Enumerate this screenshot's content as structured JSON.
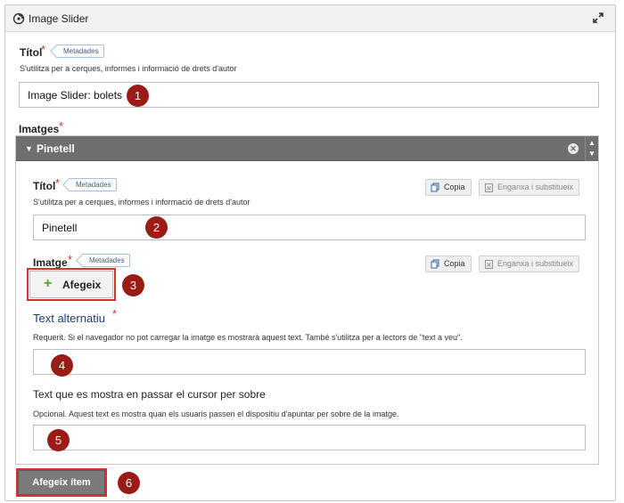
{
  "header": {
    "title": "Image Slider",
    "title_icon": "slider-icon",
    "expand_icon": "expand-icon"
  },
  "titol": {
    "label": "Títol",
    "required_mark": "*",
    "badge": "Metadades",
    "help": "S'utilitza per a cerques, informes i informació de drets d'autor",
    "value": "Image Slider: bolets"
  },
  "imatges": {
    "label": "Imatges",
    "required_mark": "*",
    "item": {
      "title": "Pinetell",
      "caret": "▼",
      "close": "✕",
      "titol": {
        "label": "Títol",
        "required_mark": "*",
        "badge": "Metadades",
        "help": "S'utilitza per a cerques, informes i informació de drets d'autor",
        "value": "Pinetell",
        "copy": "Copia",
        "paste": "Enganxa i substitueix"
      },
      "imatge": {
        "label": "Imatge",
        "required_mark": "*",
        "badge": "Metadades",
        "add": "Afegeix",
        "add_icon": "+",
        "copy": "Copia",
        "paste": "Enganxa i substitueix"
      },
      "alt": {
        "label": "Text alternatiu",
        "required_mark": "*",
        "help": "Requerit. Si el navegador no pot carregar la imatge es mostrarà aquest text. També s'utilitza per a lectors de \"text a veu\".",
        "value": ""
      },
      "hover": {
        "label": "Text que es mostra en passar el cursor per sobre",
        "help": "Opcional. Aquest text es mostra quan els usuaris passen el dispositiu d'apuntar per sobre de la imatge.",
        "value": ""
      }
    },
    "add_item": "Afegeix ítem"
  },
  "callouts": [
    "1",
    "2",
    "3",
    "4",
    "5",
    "6"
  ],
  "colors": {
    "callout": "#9b1b16",
    "highlight": "#d9302a",
    "panel_header": "#6f6f6f",
    "required": "#c0392b"
  }
}
